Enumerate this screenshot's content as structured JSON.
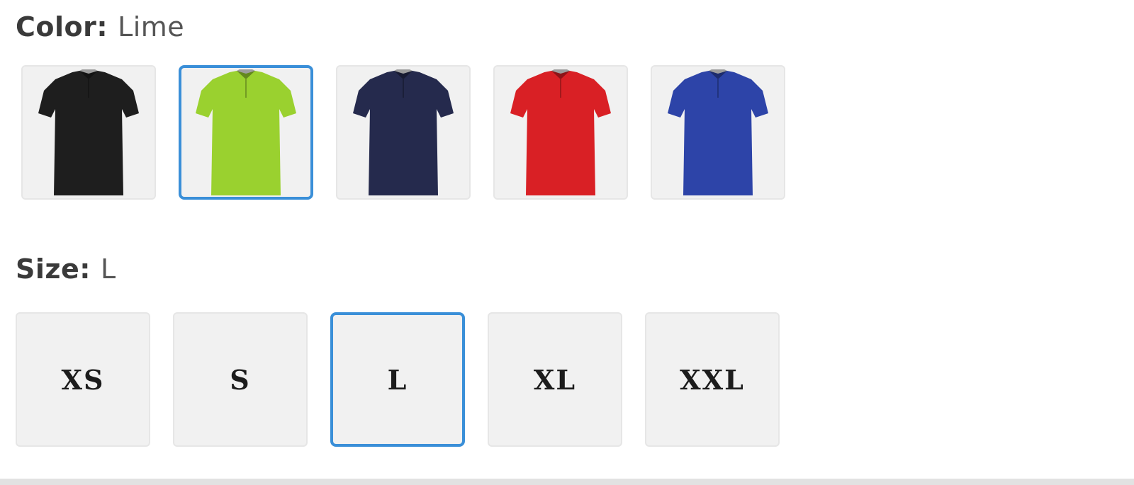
{
  "color_option": {
    "label": "Color:",
    "selected_value": "Lime",
    "swatches": [
      {
        "name": "Black",
        "hex": "#1e1e1e",
        "selected": false
      },
      {
        "name": "Lime",
        "hex": "#9ad12f",
        "selected": true
      },
      {
        "name": "Navy",
        "hex": "#252a4d",
        "selected": false
      },
      {
        "name": "Red",
        "hex": "#d92025",
        "selected": false
      },
      {
        "name": "Royal Blue",
        "hex": "#2d44a8",
        "selected": false
      }
    ]
  },
  "size_option": {
    "label": "Size:",
    "selected_value": "L",
    "swatches": [
      {
        "label": "XS",
        "selected": false
      },
      {
        "label": "S",
        "selected": false
      },
      {
        "label": "L",
        "selected": true
      },
      {
        "label": "XL",
        "selected": false
      },
      {
        "label": "XXL",
        "selected": false
      }
    ]
  },
  "colors": {
    "selected_border": "#3a8fd8",
    "swatch_background": "#f1f1f1",
    "swatch_border": "#e6e6e6"
  }
}
